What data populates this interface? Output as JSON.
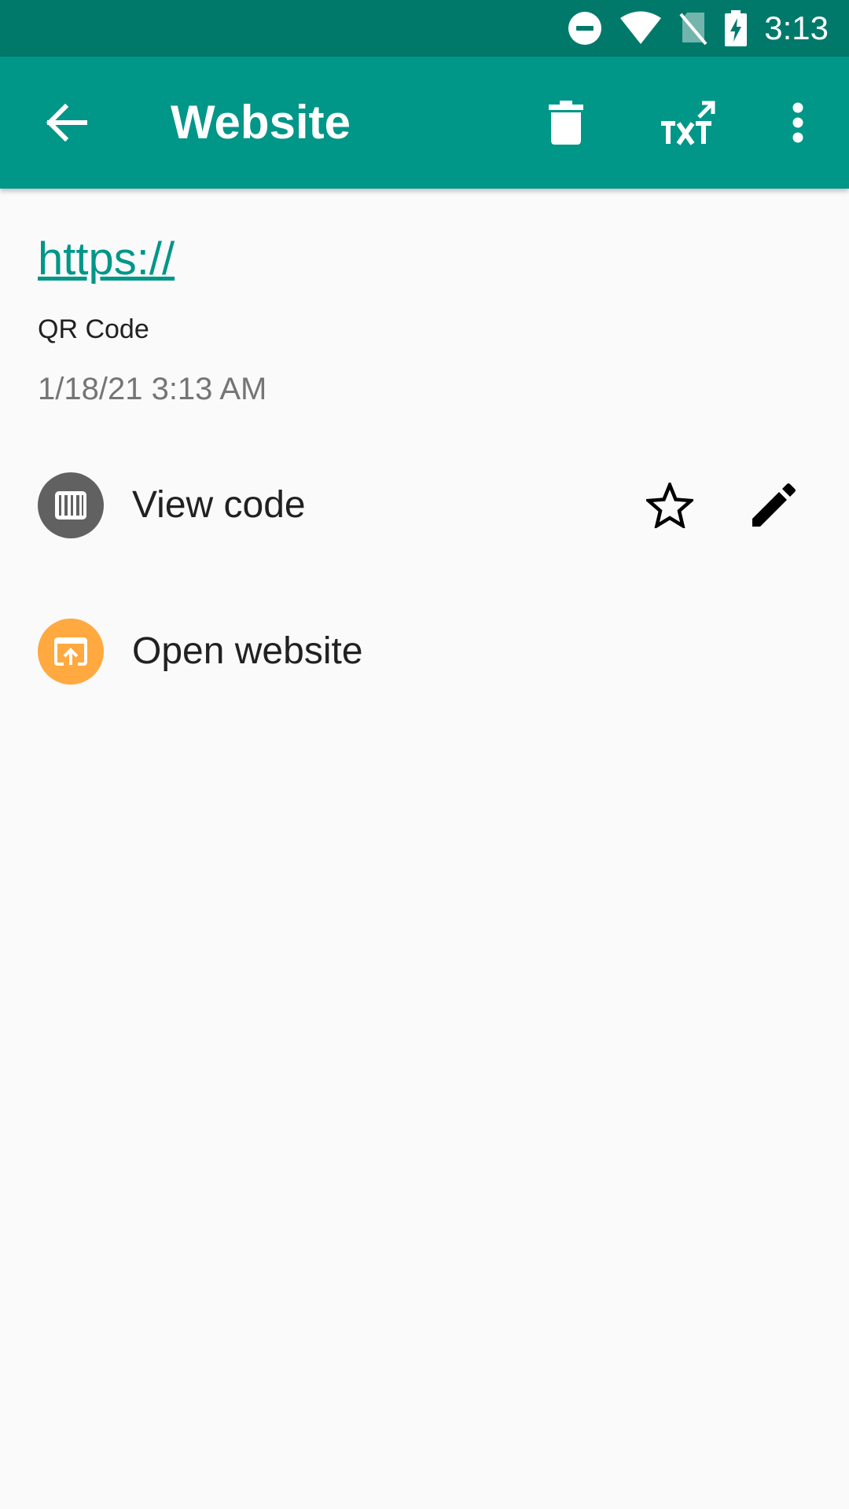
{
  "status_bar": {
    "time": "3:13",
    "icons": [
      "do-not-disturb-icon",
      "wifi-icon",
      "no-sim-icon",
      "battery-charging-icon"
    ]
  },
  "app_bar": {
    "title": "Website",
    "actions": [
      "back-arrow-icon",
      "delete-icon",
      "export-txt-icon",
      "more-vert-icon"
    ]
  },
  "barcode": {
    "text": "https://",
    "format": "QR Code",
    "date": "1/18/21 3:13 AM"
  },
  "actions": {
    "view_code_label": "View code",
    "open_website_label": "Open website"
  },
  "colors": {
    "status_bar": "#00796b",
    "app_bar": "#009688",
    "link": "#009688",
    "view_code_icon_bg": "#616161",
    "open_website_icon_bg": "#ffa940"
  }
}
